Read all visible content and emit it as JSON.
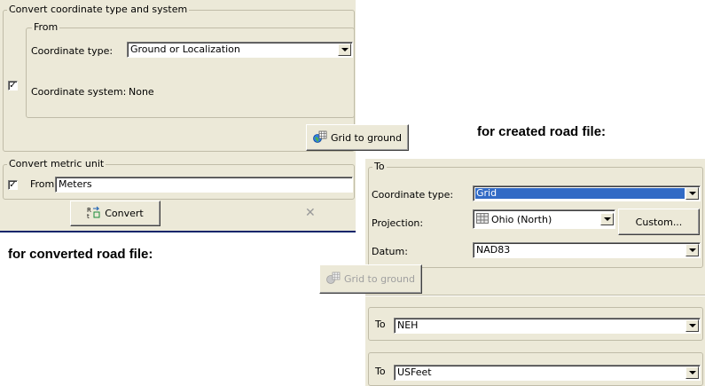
{
  "left_panel": {
    "group_title": "Convert coordinate type and system",
    "from_title": "From",
    "coord_type_label": "Coordinate type:",
    "coord_type_value": "Ground or Localization",
    "checkbox_mark": "✓",
    "coord_system_label": "Coordinate system:",
    "coord_system_value": "None",
    "grid_to_ground_label": "Grid to ground",
    "metric_group_title": "Convert metric unit",
    "from_label": "From",
    "from_value": "Meters",
    "convert_label": "Convert",
    "close_glyph": "✕"
  },
  "captions": {
    "created": "for created road file:",
    "converted": "for converted road file:"
  },
  "right_panel": {
    "to_title": "To",
    "coord_type_label": "Coordinate type:",
    "coord_type_value": "Grid",
    "projection_label": "Projection:",
    "projection_value": "Ohio (North)",
    "custom_label": "Custom...",
    "datum_label": "Datum:",
    "datum_value": "NAD83",
    "grid_to_ground_label": "Grid to ground",
    "to_label_1": "To",
    "to_value_1": "NEH",
    "to_label_2": "To",
    "to_value_2": "USFeet"
  },
  "colors": {
    "panel_bg": "#ece9d8",
    "selection": "#316ac5",
    "accent_blue": "#0a246a"
  }
}
